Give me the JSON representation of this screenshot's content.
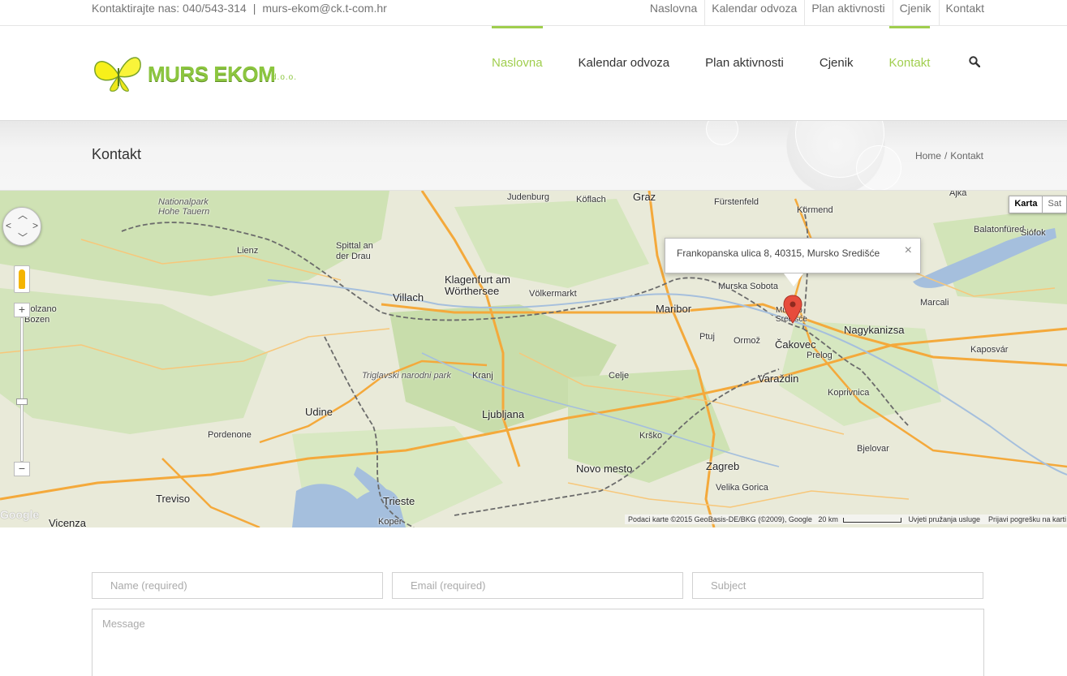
{
  "topbar": {
    "contact_label": "Kontaktirajte nas: 040/543-314",
    "separator": "|",
    "email": "murs-ekom@ck.t-com.hr",
    "secondary_nav": [
      "Naslovna",
      "Kalendar odvoza",
      "Plan aktivnosti",
      "Cjenik",
      "Kontakt"
    ]
  },
  "logo": {
    "brand": "MURS EKOM",
    "suffix": "d.o.o."
  },
  "main_nav": [
    {
      "label": "Naslovna",
      "active": true
    },
    {
      "label": "Kalendar odvoza",
      "active": false
    },
    {
      "label": "Plan aktivnosti",
      "active": false
    },
    {
      "label": "Cjenik",
      "active": false
    },
    {
      "label": "Kontakt",
      "active": true
    }
  ],
  "page_title": "Kontakt",
  "breadcrumb": {
    "home": "Home",
    "divider": "/",
    "current": "Kontakt"
  },
  "map": {
    "type_buttons": {
      "map": "Karta",
      "satellite": "Sat"
    },
    "info_window": "Frankopanska ulica 8, 40315, Mursko Središće",
    "attribution": "Podaci karte ©2015 GeoBasis-DE/BKG (©2009), Google",
    "scale_label": "20 km",
    "terms": "Uvjeti pružanja usluge",
    "report": "Prijavi pogrešku na karti",
    "watermark": "Google",
    "colors": {
      "land": "#e9ead9",
      "forest": "#c9dfae",
      "water": "#a5bfdd",
      "highway": "#f4a93b",
      "border": "#6b6b6b"
    },
    "places": [
      {
        "name": "Judenburg"
      },
      {
        "name": "Köflach"
      },
      {
        "name": "Graz"
      },
      {
        "name": "Fürstenfeld"
      },
      {
        "name": "Körmend"
      },
      {
        "name": "Ajka"
      },
      {
        "name": "Nationalpark Hohe Tauern"
      },
      {
        "name": "Villach"
      },
      {
        "name": "Klagenfurt am Wörthersee"
      },
      {
        "name": "Völkermarkt"
      },
      {
        "name": "Maribor"
      },
      {
        "name": "Murska Sobota"
      },
      {
        "name": "Mursko Središće"
      },
      {
        "name": "Čakovec"
      },
      {
        "name": "Nagykanizsa"
      },
      {
        "name": "Varaždin"
      },
      {
        "name": "Ptuj"
      },
      {
        "name": "Ljubljana"
      },
      {
        "name": "Kranj"
      },
      {
        "name": "Celje"
      },
      {
        "name": "Zagreb"
      },
      {
        "name": "Udine"
      },
      {
        "name": "Trieste"
      },
      {
        "name": "Pordenone"
      },
      {
        "name": "Treviso"
      },
      {
        "name": "Bolzano Bozen"
      },
      {
        "name": "Lienz"
      },
      {
        "name": "Spittal an der Drau"
      },
      {
        "name": "Kaposvár"
      },
      {
        "name": "Marcali"
      },
      {
        "name": "Balatonfüred"
      },
      {
        "name": "Siófok"
      },
      {
        "name": "Koprivnica"
      },
      {
        "name": "Bjelovar"
      },
      {
        "name": "Novo mesto"
      },
      {
        "name": "Velika Gorica"
      },
      {
        "name": "Vicenza"
      },
      {
        "name": "Koper"
      },
      {
        "name": "Triglavski narodni park"
      },
      {
        "name": "Prelog"
      },
      {
        "name": "Ormož"
      },
      {
        "name": "Krško"
      }
    ]
  },
  "form": {
    "name_placeholder": "Name (required)",
    "email_placeholder": "Email (required)",
    "subject_placeholder": "Subject",
    "message_placeholder": "Message"
  }
}
